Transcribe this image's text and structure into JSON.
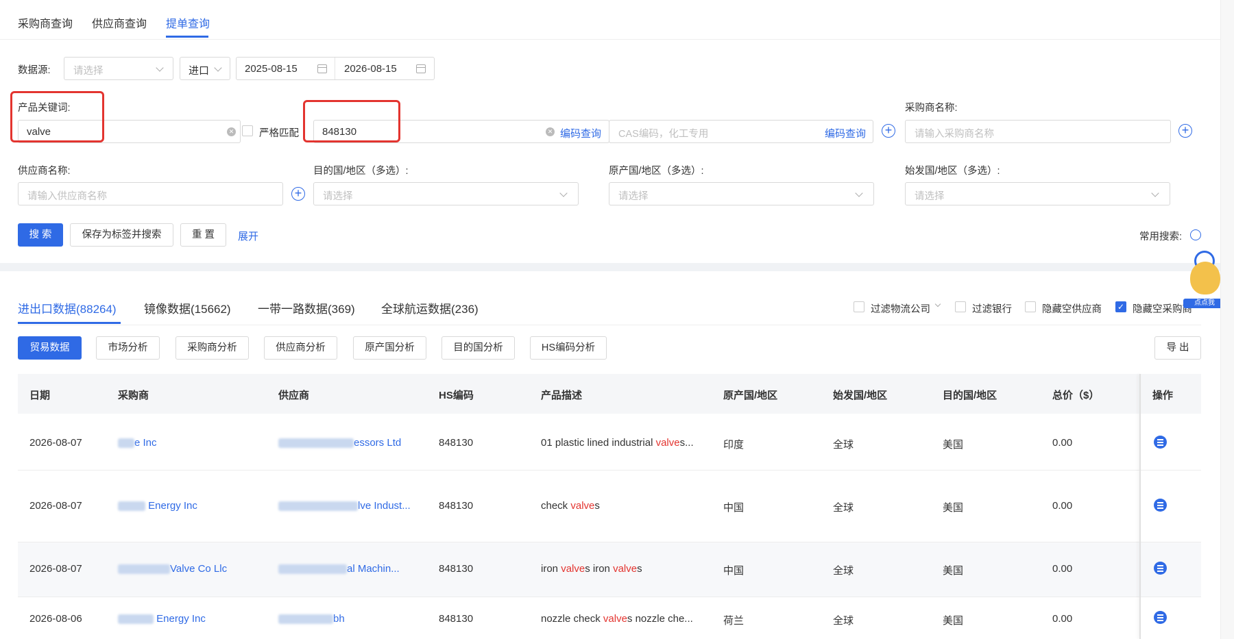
{
  "nav": {
    "tabs": [
      "采购商查询",
      "供应商查询",
      "提单查询"
    ],
    "active": 2
  },
  "filters": {
    "datasource_label": "数据源:",
    "datasource_placeholder": "请选择",
    "direction": "进口",
    "date_start": "2025-08-15",
    "date_end": "2026-08-15",
    "keyword_label": "产品关键词:",
    "keyword_value": "valve",
    "strict_match": "严格匹配",
    "hs_value": "848130",
    "code_query": "编码查询",
    "cas_placeholder": "CAS编码，化工专用",
    "cas_code_query": "编码查询",
    "buyer_label": "采购商名称:",
    "buyer_placeholder": "请输入采购商名称",
    "supplier_label": "供应商名称:",
    "supplier_placeholder": "请输入供应商名称",
    "dest_label": "目的国/地区（多选）:",
    "dest_placeholder": "请选择",
    "origin_label": "原产国/地区（多选）:",
    "origin_placeholder": "请选择",
    "depart_label": "始发国/地区（多选）:",
    "depart_placeholder": "请选择"
  },
  "actions": {
    "search": "搜 索",
    "save_search": "保存为标签并搜索",
    "reset": "重 置",
    "expand": "展开",
    "common_search": "常用搜索:"
  },
  "data_tabs": [
    "进出口数据(88264)",
    "镜像数据(15662)",
    "一带一路数据(369)",
    "全球航运数据(236)"
  ],
  "toggles": [
    {
      "label": "过滤物流公司",
      "checked": false
    },
    {
      "label": "过滤银行",
      "checked": false
    },
    {
      "label": "隐藏空供应商",
      "checked": false
    },
    {
      "label": "隐藏空采购商",
      "checked": true
    }
  ],
  "mascot_text": "点点我",
  "sub_tabs": [
    "贸易数据",
    "市场分析",
    "采购商分析",
    "供应商分析",
    "原产国分析",
    "目的国分析",
    "HS编码分析"
  ],
  "export": "导 出",
  "table": {
    "headers": [
      "日期",
      "采购商",
      "供应商",
      "HS编码",
      "产品描述",
      "原产国/地区",
      "始发国/地区",
      "目的国/地区",
      "总价（$）",
      "操作"
    ],
    "rows": [
      {
        "date": "2026-08-07",
        "buyer": "e Inc",
        "supplier": "essors Ltd",
        "hs": "848130",
        "desc_pre": "01 plastic lined industrial ",
        "desc_hl": "valve",
        "desc_post": "s...",
        "origin": "印度",
        "depart": "全球",
        "dest": "美国",
        "total": "0.00"
      },
      {
        "date": "2026-08-07",
        "buyer": "Energy Inc",
        "supplier": "lve Indust...",
        "hs": "848130",
        "desc_pre": "check ",
        "desc_hl": "valve",
        "desc_post": "s",
        "origin": "中国",
        "depart": "全球",
        "dest": "美国",
        "total": "0.00"
      },
      {
        "date": "2026-08-07",
        "buyer": "Valve Co Llc",
        "supplier": "al Machin...",
        "hs": "848130",
        "desc_pre": "iron ",
        "desc_hl": "valve",
        "desc_mid": "s iron ",
        "desc_hl2": "valve",
        "desc_post": "s",
        "origin": "中国",
        "depart": "全球",
        "dest": "美国",
        "total": "0.00"
      },
      {
        "date": "2026-08-06",
        "buyer": "Energy Inc",
        "supplier": "bh",
        "hs": "848130",
        "desc_pre": "nozzle check ",
        "desc_hl": "valve",
        "desc_post": "s nozzle che...",
        "origin": "荷兰",
        "depart": "全球",
        "dest": "美国",
        "total": "0.00"
      }
    ]
  }
}
